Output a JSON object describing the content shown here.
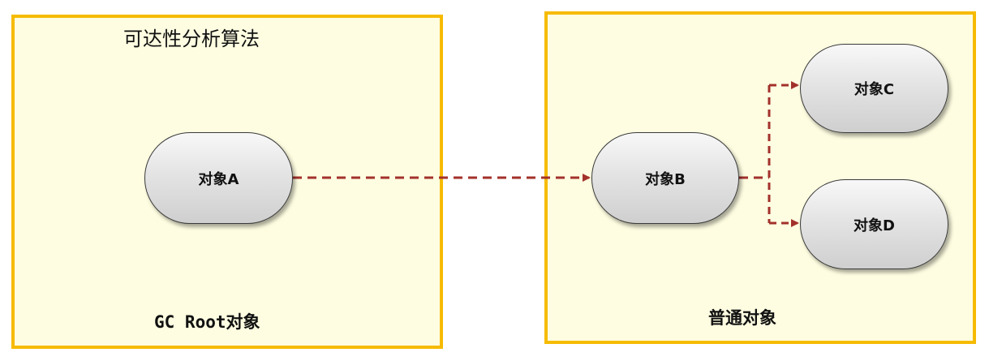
{
  "colors": {
    "region_fill": "#fefde1",
    "region_border": "#f6bb00",
    "edge": "#a3312b",
    "node_border": "#3a3a3a"
  },
  "diagram": {
    "title": "可达性分析算法",
    "regions": {
      "gc_root_label": "GC Root对象",
      "normal_label": "普通对象"
    },
    "nodes": {
      "a": "对象A",
      "b": "对象B",
      "c": "对象C",
      "d": "对象D"
    },
    "edges": [
      {
        "from": "对象A",
        "to": "对象B",
        "style": "dashed"
      },
      {
        "from": "对象B",
        "to": "对象C",
        "style": "dashed"
      },
      {
        "from": "对象B",
        "to": "对象D",
        "style": "dashed"
      }
    ]
  }
}
